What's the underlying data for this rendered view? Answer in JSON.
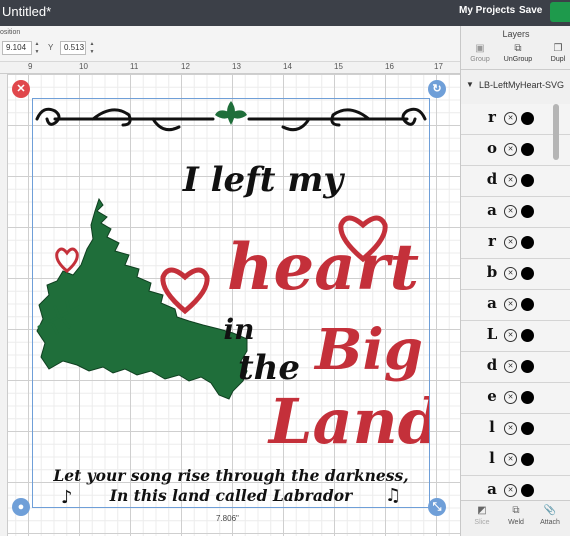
{
  "app": {
    "title": "Untitled*",
    "my_projects": "My Projects",
    "save": "Save"
  },
  "position": {
    "label": "osition",
    "x_value": "9.104",
    "y_label": "Y",
    "y_value": "0.513"
  },
  "canvas": {
    "ruler_ticks": [
      "9",
      "10",
      "11",
      "12",
      "13",
      "14",
      "15",
      "16",
      "17"
    ],
    "width_label": "7.806\"",
    "artwork": {
      "line1": "I left my",
      "heart": "heart",
      "in": "in",
      "the": "the",
      "big": "Big",
      "land": "Land",
      "caption1": "Let your song rise through the darkness,",
      "caption2": "In this land called Labrador",
      "colors": {
        "green": "#1f6e3a",
        "red": "#c4303a",
        "black": "#111111"
      }
    }
  },
  "layers_panel": {
    "title": "Layers",
    "tools": [
      "Group",
      "UnGroup",
      "Dupl"
    ],
    "group_name": "LB-LeftMyHeart-SVG",
    "layers": [
      "r",
      "o",
      "d",
      "a",
      "r",
      "b",
      "a",
      "L",
      "d",
      "e",
      "l",
      "l",
      "a"
    ],
    "bottom_tools": [
      "Slice",
      "Weld",
      "Attach"
    ]
  }
}
